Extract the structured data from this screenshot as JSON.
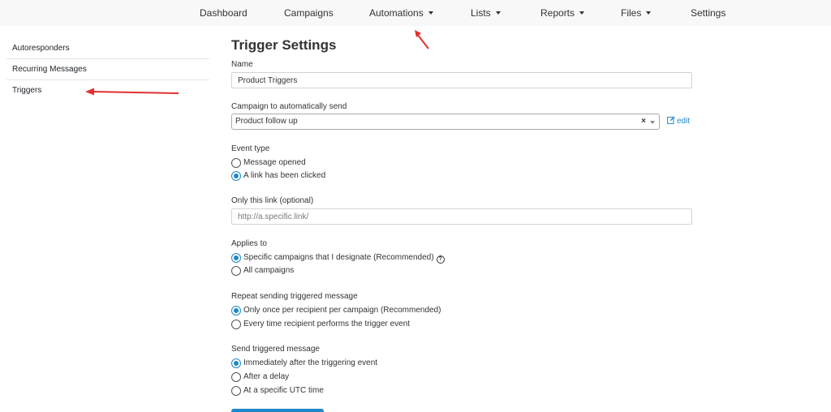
{
  "nav": {
    "dashboard": "Dashboard",
    "campaigns": "Campaigns",
    "automations": "Automations",
    "lists": "Lists",
    "reports": "Reports",
    "files": "Files",
    "settings": "Settings"
  },
  "sidebar": {
    "items": [
      {
        "label": "Autoresponders"
      },
      {
        "label": "Recurring Messages"
      },
      {
        "label": "Triggers"
      }
    ]
  },
  "form": {
    "title": "Trigger Settings",
    "name_label": "Name",
    "name_value": "Product Triggers",
    "campaign_label": "Campaign to automatically send",
    "campaign_value": "Product follow up",
    "campaign_clear": "×",
    "edit_label": "edit",
    "event_type_label": "Event type",
    "event_options": [
      {
        "label": "Message opened",
        "selected": false
      },
      {
        "label": "A link has been clicked",
        "selected": true
      }
    ],
    "link_label": "Only this link (optional)",
    "link_placeholder": "http://a.specific.link/",
    "applies_label": "Applies to",
    "applies_options": [
      {
        "label": "Specific campaigns that I designate (Recommended)",
        "selected": true
      },
      {
        "label": "All campaigns",
        "selected": false
      }
    ],
    "repeat_label": "Repeat sending triggered message",
    "repeat_options": [
      {
        "label": "Only once per recipient per campaign (Recommended)",
        "selected": true
      },
      {
        "label": "Every time recipient performs the trigger event",
        "selected": false
      }
    ],
    "send_label": "Send triggered message",
    "send_options": [
      {
        "label": "Immediately after the triggering event",
        "selected": true
      },
      {
        "label": "After a delay",
        "selected": false
      },
      {
        "label": "At a specific UTC time",
        "selected": false
      }
    ]
  },
  "colors": {
    "accent": "#1e88c9",
    "annotation_arrow": "#e03131",
    "nav_background": "#f8f8f8"
  }
}
